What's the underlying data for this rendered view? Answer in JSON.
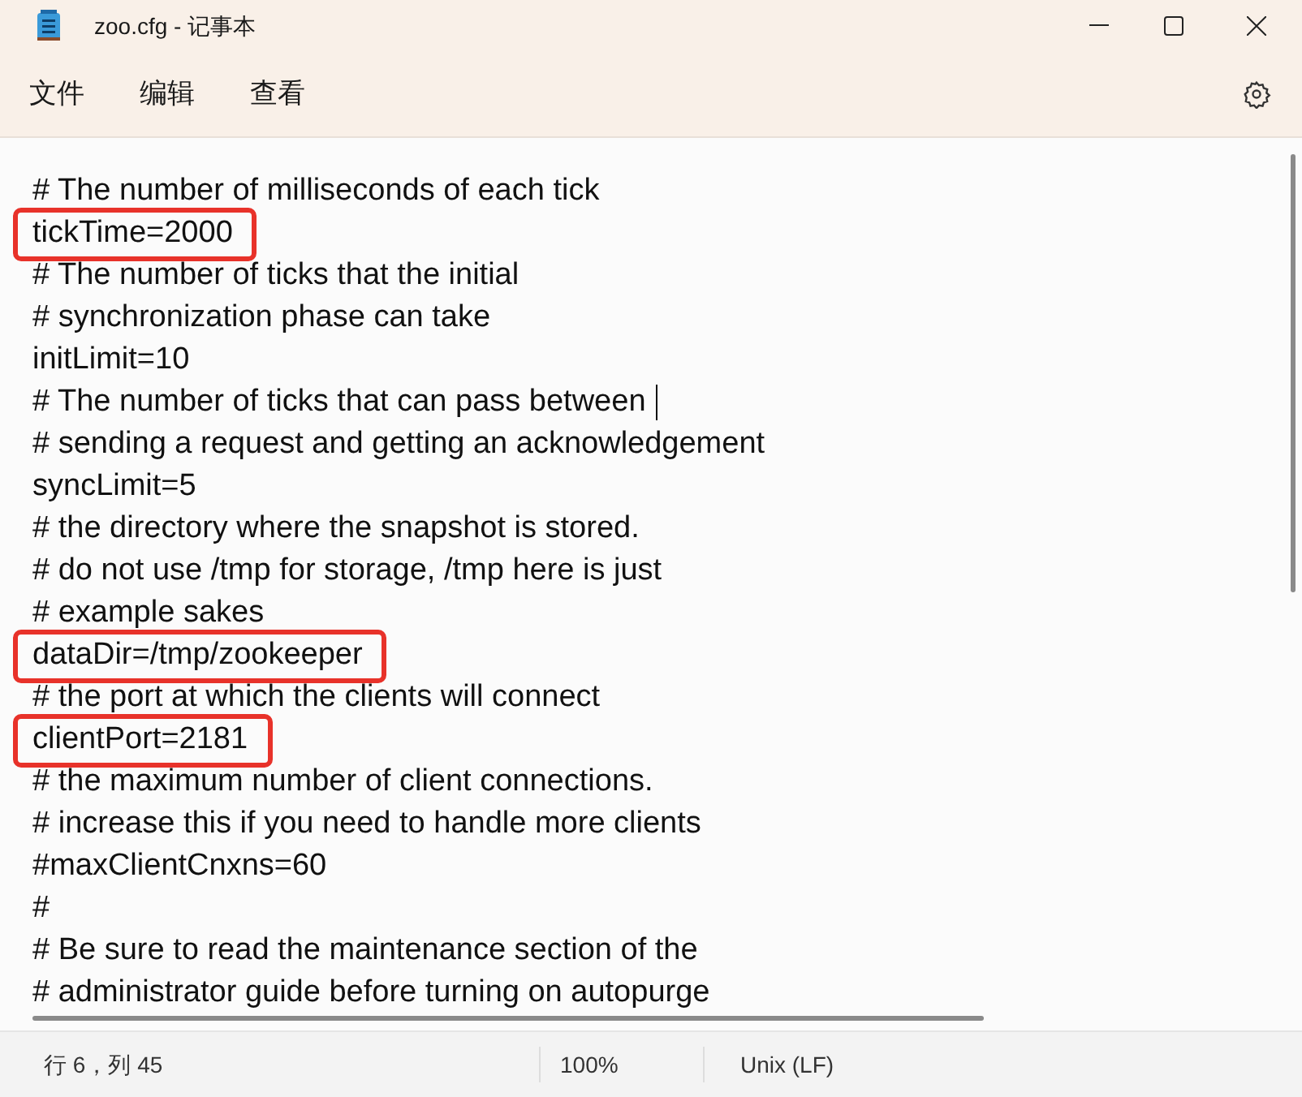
{
  "window": {
    "title": "zoo.cfg - 记事本"
  },
  "menu": [
    {
      "label": "文件"
    },
    {
      "label": "编辑"
    },
    {
      "label": "查看"
    }
  ],
  "editor": {
    "lines": [
      {
        "text": "# The number of milliseconds of each tick",
        "highlighted": false,
        "cursor": false
      },
      {
        "text": "tickTime=2000",
        "highlighted": true,
        "cursor": false
      },
      {
        "text": "# The number of ticks that the initial",
        "highlighted": false,
        "cursor": false
      },
      {
        "text": "# synchronization phase can take",
        "highlighted": false,
        "cursor": false
      },
      {
        "text": "initLimit=10",
        "highlighted": false,
        "cursor": false
      },
      {
        "text": "# The number of ticks that can pass between",
        "highlighted": false,
        "cursor": true
      },
      {
        "text": "# sending a request and getting an acknowledgement",
        "highlighted": false,
        "cursor": false
      },
      {
        "text": "syncLimit=5",
        "highlighted": false,
        "cursor": false
      },
      {
        "text": "# the directory where the snapshot is stored.",
        "highlighted": false,
        "cursor": false
      },
      {
        "text": "# do not use /tmp for storage, /tmp here is just",
        "highlighted": false,
        "cursor": false
      },
      {
        "text": "# example sakes",
        "highlighted": false,
        "cursor": false
      },
      {
        "text": "dataDir=/tmp/zookeeper",
        "highlighted": true,
        "cursor": false
      },
      {
        "text": "# the port at which the clients will connect",
        "highlighted": false,
        "cursor": false
      },
      {
        "text": "clientPort=2181",
        "highlighted": true,
        "cursor": false
      },
      {
        "text": "# the maximum number of client connections.",
        "highlighted": false,
        "cursor": false
      },
      {
        "text": "# increase this if you need to handle more clients",
        "highlighted": false,
        "cursor": false
      },
      {
        "text": "#maxClientCnxns=60",
        "highlighted": false,
        "cursor": false
      },
      {
        "text": "#",
        "highlighted": false,
        "cursor": false
      },
      {
        "text": "# Be sure to read the maintenance section of the",
        "highlighted": false,
        "cursor": false
      },
      {
        "text": "# administrator guide before turning on autopurge",
        "highlighted": false,
        "cursor": false
      }
    ]
  },
  "status_bar": {
    "position": "行 6，列 45",
    "zoom": "100%",
    "line_ending": "Unix (LF)"
  }
}
